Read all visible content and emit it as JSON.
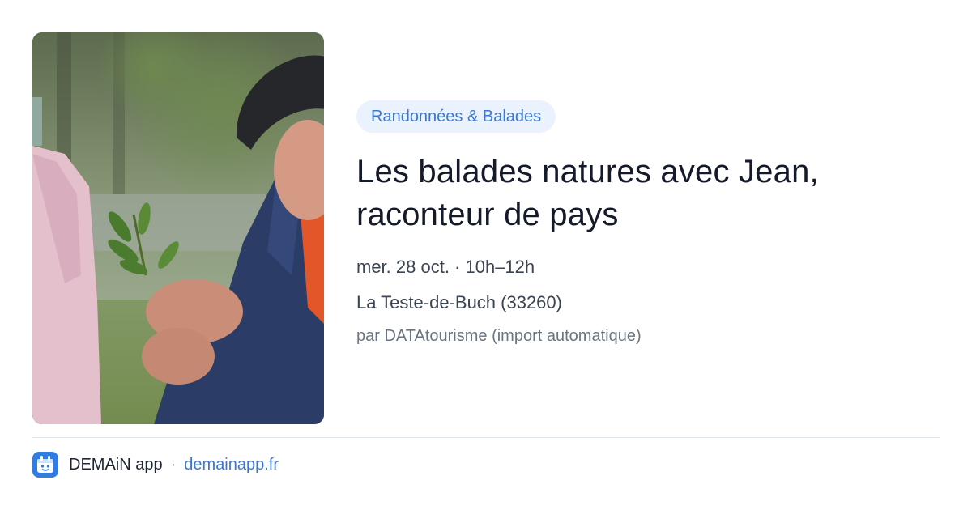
{
  "event": {
    "category": "Randonnées & Balades",
    "title": "Les balades natures avec Jean, raconteur de pays",
    "datetime": "mer. 28 oct. · 10h–12h",
    "location": "La Teste-de-Buch (33260)",
    "source": "par DATAtourisme (import automatique)"
  },
  "footer": {
    "app_name": "DEMAiN app",
    "separator": "·",
    "site": "demainapp.fr",
    "logo_icon": "demain-app-logo-icon"
  },
  "colors": {
    "accent": "#3a78d4",
    "chip_background": "#eaf2fd",
    "title": "#141a2a",
    "logo": "#2f7de0"
  }
}
